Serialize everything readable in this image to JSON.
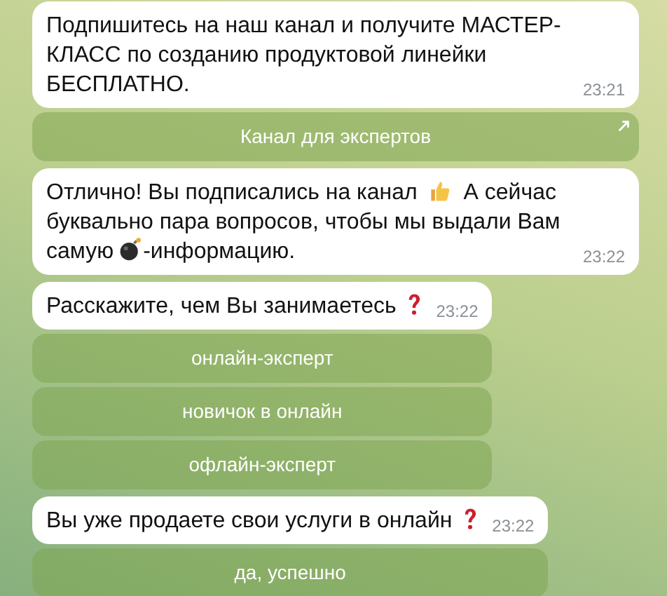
{
  "messages": [
    {
      "parts": [
        {
          "kind": "text",
          "text": "Подпишитесь на наш канал и получите МАСТЕР-КЛАСС по созданию продуктовой линейки БЕСПЛАТНО."
        }
      ],
      "time": "23:21",
      "buttons": [
        {
          "label": "Канал для экспертов",
          "kind": "url"
        }
      ]
    },
    {
      "parts": [
        {
          "kind": "text",
          "text": "Отлично! Вы подписались на канал"
        },
        {
          "kind": "thumbs-up"
        },
        {
          "kind": "text",
          "text": "А сейчас"
        },
        {
          "kind": "text",
          "text": "буквально пара вопросов, чтобы мы выдали Вам"
        },
        {
          "kind": "text",
          "text": "самую"
        },
        {
          "kind": "bomb"
        },
        {
          "kind": "text",
          "text": "-информацию."
        }
      ],
      "time": "23:22"
    },
    {
      "parts": [
        {
          "kind": "text",
          "text": "Расскажите, чем Вы занимаетесь"
        },
        {
          "kind": "question"
        }
      ],
      "time": "23:22",
      "buttons": [
        {
          "label": "онлайн-эксперт",
          "kind": "callback"
        },
        {
          "label": "новичок в онлайн",
          "kind": "callback"
        },
        {
          "label": "офлайн-эксперт",
          "kind": "callback"
        }
      ]
    },
    {
      "parts": [
        {
          "kind": "text",
          "text": "Вы уже продаете свои услуги в онлайн"
        },
        {
          "kind": "question"
        }
      ],
      "time": "23:22",
      "buttons": [
        {
          "label": "да, успешно",
          "kind": "callback"
        }
      ]
    }
  ]
}
